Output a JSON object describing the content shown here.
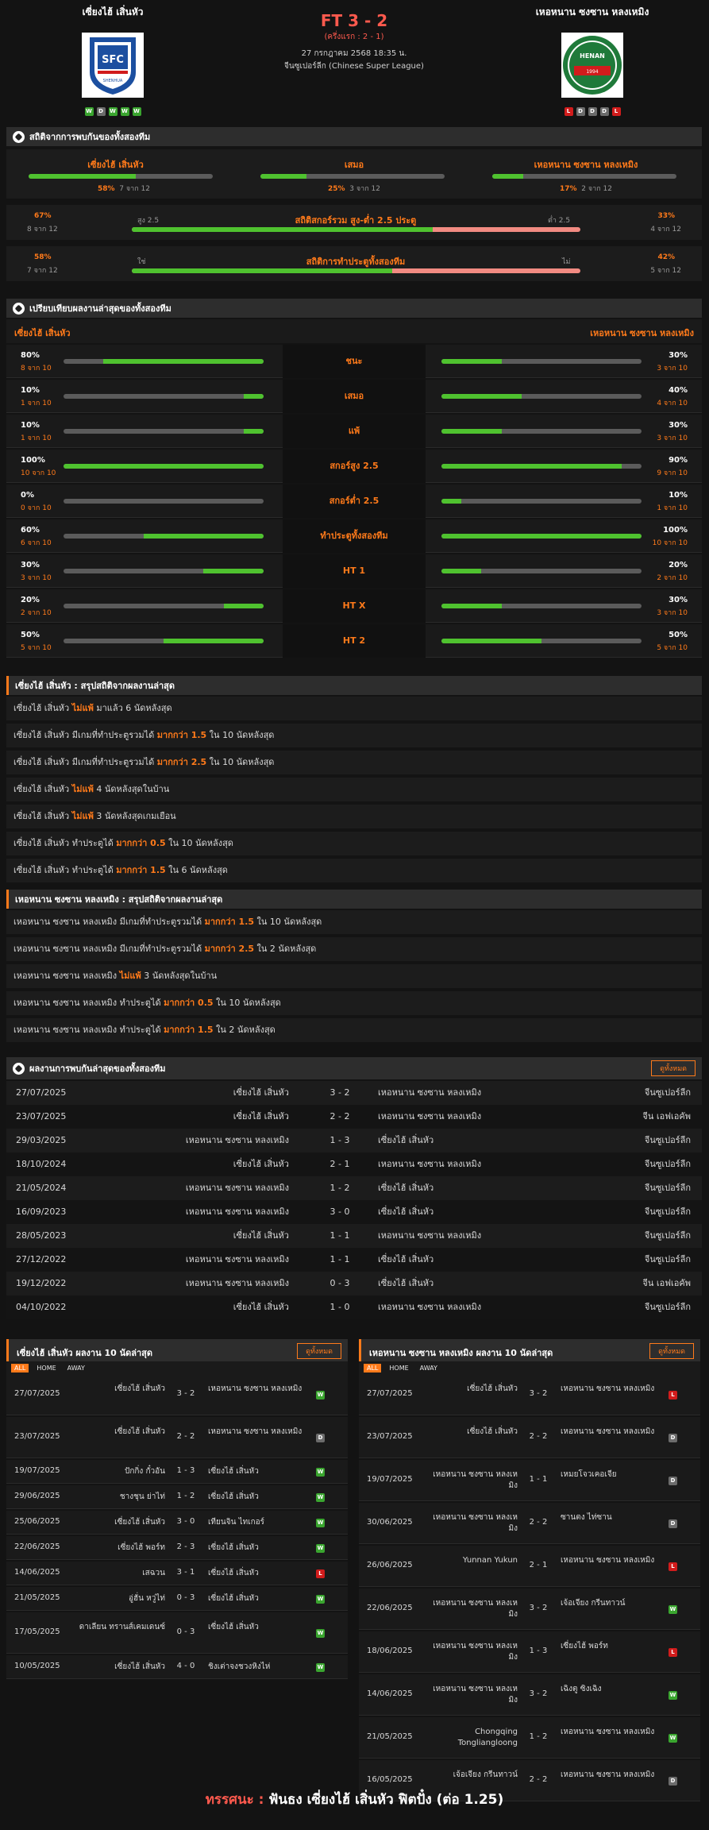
{
  "match": {
    "home": "เซี่ยงไฮ้ เสิ่นหัว",
    "away": "เหอหนาน ซงซาน หลงเหมิง",
    "score": "FT 3 - 2",
    "ht": "(ครึ่งแรก : 2 - 1)",
    "date": "27 กรกฎาคม 2568 18:35 น.",
    "league": "จีนซูเปอร์ลีก (Chinese Super League)",
    "home_form": [
      "W",
      "D",
      "W",
      "W",
      "W"
    ],
    "away_form": [
      "L",
      "D",
      "D",
      "D",
      "L"
    ],
    "home_logo_text": "SHENHUA",
    "away_logo_text": "HENAN"
  },
  "h2h_stats": {
    "title": "สถิติจากการพบกันของทั้งสองทีม",
    "home": {
      "label": "เซี่ยงไฮ้ เสิ่นหัว",
      "pct": "58%",
      "n": "7 จาก 12",
      "frac": 0.58
    },
    "draw": {
      "label": "เสมอ",
      "pct": "25%",
      "n": "3 จาก 12",
      "frac": 0.25
    },
    "away": {
      "label": "เหอหนาน ซงซาน หลงเหมิง",
      "pct": "17%",
      "n": "2 จาก 12",
      "frac": 0.17
    },
    "ou": {
      "title": "สถิติสกอร์รวม สูง-ต่ำ 2.5 ประตู",
      "left_label": "สูง 2.5",
      "right_label": "ต่ำ 2.5",
      "lp": "67%",
      "ln": "8 จาก 12",
      "rp": "33%",
      "rn": "4 จาก 12",
      "frac": 0.67
    },
    "btts": {
      "title": "สถิติการทำประตูทั้งสองทีม",
      "left_label": "ใช่",
      "right_label": "ไม่",
      "lp": "58%",
      "ln": "7 จาก 12",
      "rp": "42%",
      "rn": "5 จาก 12",
      "frac": 0.58
    }
  },
  "compare": {
    "title": "เปรียบเทียบผลงานล่าสุดของทั้งสองทีม",
    "home": "เซี่ยงไฮ้ เสิ่นหัว",
    "away": "เหอหนาน ซงซาน หลงเหมิง",
    "rows": [
      {
        "label": "ชนะ",
        "lv": "80%",
        "ln": "8 จาก 10",
        "lf": 0.8,
        "rv": "30%",
        "rn": "3 จาก 10",
        "rf": 0.3
      },
      {
        "label": "เสมอ",
        "lv": "10%",
        "ln": "1 จาก 10",
        "lf": 0.1,
        "rv": "40%",
        "rn": "4 จาก 10",
        "rf": 0.4
      },
      {
        "label": "แพ้",
        "lv": "10%",
        "ln": "1 จาก 10",
        "lf": 0.1,
        "rv": "30%",
        "rn": "3 จาก 10",
        "rf": 0.3
      },
      {
        "label": "สกอร์สูง 2.5",
        "lv": "100%",
        "ln": "10 จาก 10",
        "lf": 1.0,
        "rv": "90%",
        "rn": "9 จาก 10",
        "rf": 0.9
      },
      {
        "label": "สกอร์ต่ำ 2.5",
        "lv": "0%",
        "ln": "0 จาก 10",
        "lf": 0.0,
        "rv": "10%",
        "rn": "1 จาก 10",
        "rf": 0.1
      },
      {
        "label": "ทำประตูทั้งสองทีม",
        "lv": "60%",
        "ln": "6 จาก 10",
        "lf": 0.6,
        "rv": "100%",
        "rn": "10 จาก 10",
        "rf": 1.0
      },
      {
        "label": "HT 1",
        "lv": "30%",
        "ln": "3 จาก 10",
        "lf": 0.3,
        "rv": "20%",
        "rn": "2 จาก 10",
        "rf": 0.2
      },
      {
        "label": "HT X",
        "lv": "20%",
        "ln": "2 จาก 10",
        "lf": 0.2,
        "rv": "30%",
        "rn": "3 จาก 10",
        "rf": 0.3
      },
      {
        "label": "HT 2",
        "lv": "50%",
        "ln": "5 จาก 10",
        "lf": 0.5,
        "rv": "50%",
        "rn": "5 จาก 10",
        "rf": 0.5
      }
    ]
  },
  "home_summary": {
    "title": "เซี่ยงไฮ้ เสิ่นหัว : สรุปสถิติจากผลงานล่าสุด",
    "lines": [
      {
        "a": "เซี่ยงไฮ้ เสิ่นหัว ",
        "b": "ไม่แพ้",
        "c": " มาแล้ว 6 นัดหลังสุด"
      },
      {
        "a": "เซี่ยงไฮ้ เสิ่นหัว  มีเกมที่ทำประตูรวมได้ ",
        "b": "มากกว่า 1.5",
        "c": " ใน 10 นัดหลังสุด"
      },
      {
        "a": "เซี่ยงไฮ้ เสิ่นหัว  มีเกมที่ทำประตูรวมได้ ",
        "b": "มากกว่า 2.5",
        "c": " ใน 10 นัดหลังสุด"
      },
      {
        "a": "เซี่ยงไฮ้ เสิ่นหัว ",
        "b": "ไม่แพ้",
        "c": " 4 นัดหลังสุดในบ้าน"
      },
      {
        "a": "เซี่ยงไฮ้ เสิ่นหัว ",
        "b": "ไม่แพ้",
        "c": " 3 นัดหลังสุดเกมเยือน"
      },
      {
        "a": "เซี่ยงไฮ้ เสิ่นหัว  ทำประตูได้ ",
        "b": "มากกว่า 0.5",
        "c": " ใน 10 นัดหลังสุด"
      },
      {
        "a": "เซี่ยงไฮ้ เสิ่นหัว  ทำประตูได้ ",
        "b": "มากกว่า 1.5",
        "c": " ใน 6 นัดหลังสุด"
      }
    ]
  },
  "away_summary": {
    "title": "เหอหนาน ซงซาน หลงเหมิง : สรุปสถิติจากผลงานล่าสุด",
    "lines": [
      {
        "a": "เหอหนาน ซงซาน หลงเหมิง  มีเกมที่ทำประตูรวมได้ ",
        "b": "มากกว่า 1.5",
        "c": " ใน 10 นัดหลังสุด"
      },
      {
        "a": "เหอหนาน ซงซาน หลงเหมิง  มีเกมที่ทำประตูรวมได้ ",
        "b": "มากกว่า 2.5",
        "c": " ใน 2 นัดหลังสุด"
      },
      {
        "a": "เหอหนาน ซงซาน หลงเหมิง ",
        "b": "ไม่แพ้",
        "c": " 3 นัดหลังสุดในบ้าน"
      },
      {
        "a": "เหอหนาน ซงซาน หลงเหมิง  ทำประตูได้ ",
        "b": "มากกว่า 0.5",
        "c": " ใน 10 นัดหลังสุด"
      },
      {
        "a": "เหอหนาน ซงซาน หลงเหมิง  ทำประตูได้ ",
        "b": "มากกว่า 1.5",
        "c": " ใน 2 นัดหลังสุด"
      }
    ]
  },
  "h2h": {
    "title": "ผลงานการพบกันล่าสุดของทั้งสองทีม",
    "view_all": "ดูทั้งหมด",
    "rows": [
      {
        "date": "27/07/2025",
        "home": "เซี่ยงไฮ้ เสิ่นหัว",
        "score": "3 - 2",
        "away": "เหอหนาน ซงซาน หลงเหมิง",
        "comp": "จีนซูเปอร์ลีก"
      },
      {
        "date": "23/07/2025",
        "home": "เซี่ยงไฮ้ เสิ่นหัว",
        "score": "2 - 2",
        "away": "เหอหนาน ซงซาน หลงเหมิง",
        "comp": "จีน เอฟเอคัพ"
      },
      {
        "date": "29/03/2025",
        "home": "เหอหนาน ซงซาน หลงเหมิง",
        "score": "1 - 3",
        "away": "เซี่ยงไฮ้ เสิ่นหัว",
        "comp": "จีนซูเปอร์ลีก"
      },
      {
        "date": "18/10/2024",
        "home": "เซี่ยงไฮ้ เสิ่นหัว",
        "score": "2 - 1",
        "away": "เหอหนาน ซงซาน หลงเหมิง",
        "comp": "จีนซูเปอร์ลีก"
      },
      {
        "date": "21/05/2024",
        "home": "เหอหนาน ซงซาน หลงเหมิง",
        "score": "1 - 2",
        "away": "เซี่ยงไฮ้ เสิ่นหัว",
        "comp": "จีนซูเปอร์ลีก"
      },
      {
        "date": "16/09/2023",
        "home": "เหอหนาน ซงซาน หลงเหมิง",
        "score": "3 - 0",
        "away": "เซี่ยงไฮ้ เสิ่นหัว",
        "comp": "จีนซูเปอร์ลีก"
      },
      {
        "date": "28/05/2023",
        "home": "เซี่ยงไฮ้ เสิ่นหัว",
        "score": "1 - 1",
        "away": "เหอหนาน ซงซาน หลงเหมิง",
        "comp": "จีนซูเปอร์ลีก"
      },
      {
        "date": "27/12/2022",
        "home": "เหอหนาน ซงซาน หลงเหมิง",
        "score": "1 - 1",
        "away": "เซี่ยงไฮ้ เสิ่นหัว",
        "comp": "จีนซูเปอร์ลีก"
      },
      {
        "date": "19/12/2022",
        "home": "เหอหนาน ซงซาน หลงเหมิง",
        "score": "0 - 3",
        "away": "เซี่ยงไฮ้ เสิ่นหัว",
        "comp": "จีน เอฟเอคัพ"
      },
      {
        "date": "04/10/2022",
        "home": "เซี่ยงไฮ้ เสิ่นหัว",
        "score": "1 - 0",
        "away": "เหอหนาน ซงซาน หลงเหมิง",
        "comp": "จีนซูเปอร์ลีก"
      }
    ]
  },
  "home_recent": {
    "title": "เซี่ยงไฮ้ เสิ่นหัว ผลงาน 10 นัดล่าสุด",
    "view_all": "ดูทั้งหมด",
    "tabs": [
      "ALL",
      "HOME",
      "AWAY"
    ],
    "rows": [
      {
        "date": "27/07/2025",
        "home": "เซี่ยงไฮ้ เสิ่นหัว",
        "score": "3 - 2",
        "away": "เหอหนาน ซงซาน หลงเหมิง",
        "r": "W"
      },
      {
        "date": "23/07/2025",
        "home": "เซี่ยงไฮ้ เสิ่นหัว",
        "score": "2 - 2",
        "away": "เหอหนาน ซงซาน หลงเหมิง",
        "r": "D"
      },
      {
        "date": "19/07/2025",
        "home": "ปักกิ่ง กั๋วอัน",
        "score": "1 - 3",
        "away": "เซี่ยงไฮ้ เสิ่นหัว",
        "r": "W"
      },
      {
        "date": "29/06/2025",
        "home": "ชางชุน ย่าไท่",
        "score": "1 - 2",
        "away": "เซี่ยงไฮ้ เสิ่นหัว",
        "r": "W"
      },
      {
        "date": "25/06/2025",
        "home": "เซี่ยงไฮ้ เสิ่นหัว",
        "score": "3 - 0",
        "away": "เทียนจิน ไทเกอร์",
        "r": "W"
      },
      {
        "date": "22/06/2025",
        "home": "เซี่ยงไฮ้ พอร์ท",
        "score": "2 - 3",
        "away": "เซี่ยงไฮ้ เสิ่นหัว",
        "r": "W"
      },
      {
        "date": "14/06/2025",
        "home": "เสฉวน",
        "score": "3 - 1",
        "away": "เซี่ยงไฮ้ เสิ่นหัว",
        "r": "L"
      },
      {
        "date": "21/05/2025",
        "home": "อู่ฮั่น หวู่ไท่",
        "score": "0 - 3",
        "away": "เซี่ยงไฮ้ เสิ่นหัว",
        "r": "W"
      },
      {
        "date": "17/05/2025",
        "home": "ดาเลียน ทรานส์เคมเดนซ์",
        "score": "0 - 3",
        "away": "เซี่ยงไฮ้ เสิ่นหัว",
        "r": "W"
      },
      {
        "date": "10/05/2025",
        "home": "เซี่ยงไฮ้ เสิ่นหัว",
        "score": "4 - 0",
        "away": "ชิงเต่าจงชวงหิงไห่",
        "r": "W"
      }
    ]
  },
  "away_recent": {
    "title": "เหอหนาน ซงซาน หลงเหมิง ผลงาน 10 นัดล่าสุด",
    "view_all": "ดูทั้งหมด",
    "tabs": [
      "ALL",
      "HOME",
      "AWAY"
    ],
    "rows": [
      {
        "date": "27/07/2025",
        "home": "เซี่ยงไฮ้ เสิ่นหัว",
        "score": "3 - 2",
        "away": "เหอหนาน ซงซาน หลงเหมิง",
        "r": "L"
      },
      {
        "date": "23/07/2025",
        "home": "เซี่ยงไฮ้ เสิ่นหัว",
        "score": "2 - 2",
        "away": "เหอหนาน ซงซาน หลงเหมิง",
        "r": "D"
      },
      {
        "date": "19/07/2025",
        "home": "เหอหนาน ซงซาน หลงเหมิง",
        "score": "1 - 1",
        "away": "เหมยโจวเคอเจีย",
        "r": "D"
      },
      {
        "date": "30/06/2025",
        "home": "เหอหนาน ซงซาน หลงเหมิง",
        "score": "2 - 2",
        "away": "ซานตง ไท่ซาน",
        "r": "D"
      },
      {
        "date": "26/06/2025",
        "home": "Yunnan Yukun",
        "score": "2 - 1",
        "away": "เหอหนาน ซงซาน หลงเหมิง",
        "r": "L"
      },
      {
        "date": "22/06/2025",
        "home": "เหอหนาน ซงซาน หลงเหมิง",
        "score": "3 - 2",
        "away": "เจ้อเจียง กรีนทาวน์",
        "r": "W"
      },
      {
        "date": "18/06/2025",
        "home": "เหอหนาน ซงซาน หลงเหมิง",
        "score": "1 - 3",
        "away": "เซี่ยงไฮ้ พอร์ท",
        "r": "L"
      },
      {
        "date": "14/06/2025",
        "home": "เหอหนาน ซงซาน หลงเหมิง",
        "score": "3 - 2",
        "away": "เฉิงตู ซิงเฉิง",
        "r": "W"
      },
      {
        "date": "21/05/2025",
        "home": "Chongqing Tongliangloong",
        "score": "1 - 2",
        "away": "เหอหนาน ซงซาน หลงเหมิง",
        "r": "W"
      },
      {
        "date": "16/05/2025",
        "home": "เจ้อเจียง กรีนทาวน์",
        "score": "2 - 2",
        "away": "เหอหนาน ซงซาน หลงเหมิง",
        "r": "D"
      }
    ]
  },
  "verdict": {
    "label": "ทรรศนะ : ",
    "text": " ฟันธง เซี่ยงไฮ้ เสิ่นหัว ฟิตปั๋ง (ต่อ 1.25)"
  },
  "colors": {
    "accent": "#ff7a1a",
    "win": "#3aa52f",
    "draw": "#6b6b6b",
    "loss": "#d11c1c",
    "bar_green": "#4fc22f",
    "bar_red": "#f28b82"
  }
}
